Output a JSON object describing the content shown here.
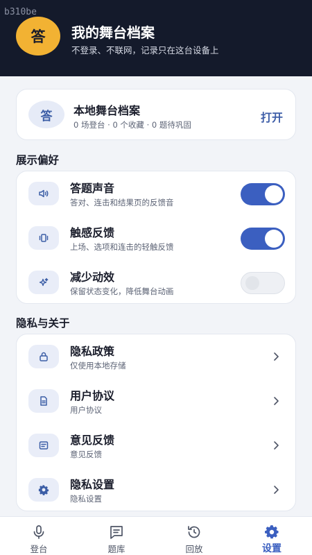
{
  "watermark": "b310be",
  "header": {
    "logo_text": "答",
    "title": "我的舞台档案",
    "subtitle": "不登录、不联网，记录只在这台设备上"
  },
  "archive": {
    "avatar_text": "答",
    "title": "本地舞台档案",
    "stats": "0 场登台 · 0 个收藏 · 0 题待巩固",
    "action": "打开"
  },
  "display_prefs": {
    "section_title": "展示偏好",
    "items": [
      {
        "title": "答题声音",
        "subtitle": "答对、连击和结果页的反馈音",
        "icon": "speaker-icon",
        "enabled": true
      },
      {
        "title": "触感反馈",
        "subtitle": "上场、选项和连击的轻触反馈",
        "icon": "vibration-icon",
        "enabled": true
      },
      {
        "title": "减少动效",
        "subtitle": "保留状态变化，降低舞台动画",
        "icon": "sparkle-icon",
        "enabled": false
      }
    ]
  },
  "privacy": {
    "section_title": "隐私与关于",
    "items": [
      {
        "title": "隐私政策",
        "subtitle": "仅使用本地存储",
        "icon": "lock-icon"
      },
      {
        "title": "用户协议",
        "subtitle": "用户协议",
        "icon": "document-icon"
      },
      {
        "title": "意见反馈",
        "subtitle": "意见反馈",
        "icon": "feedback-icon"
      },
      {
        "title": "隐私设置",
        "subtitle": "隐私设置",
        "icon": "gear-icon"
      }
    ]
  },
  "tabs": [
    {
      "label": "登台",
      "icon": "microphone-icon",
      "active": false
    },
    {
      "label": "题库",
      "icon": "question-bank-icon",
      "active": false
    },
    {
      "label": "回放",
      "icon": "replay-icon",
      "active": false
    },
    {
      "label": "设置",
      "icon": "gear-icon",
      "active": true
    }
  ],
  "colors": {
    "header_bg": "#141a2b",
    "logo": "#f2b233",
    "accent": "#3b5fc0",
    "page_bg": "#f2f4f8"
  }
}
